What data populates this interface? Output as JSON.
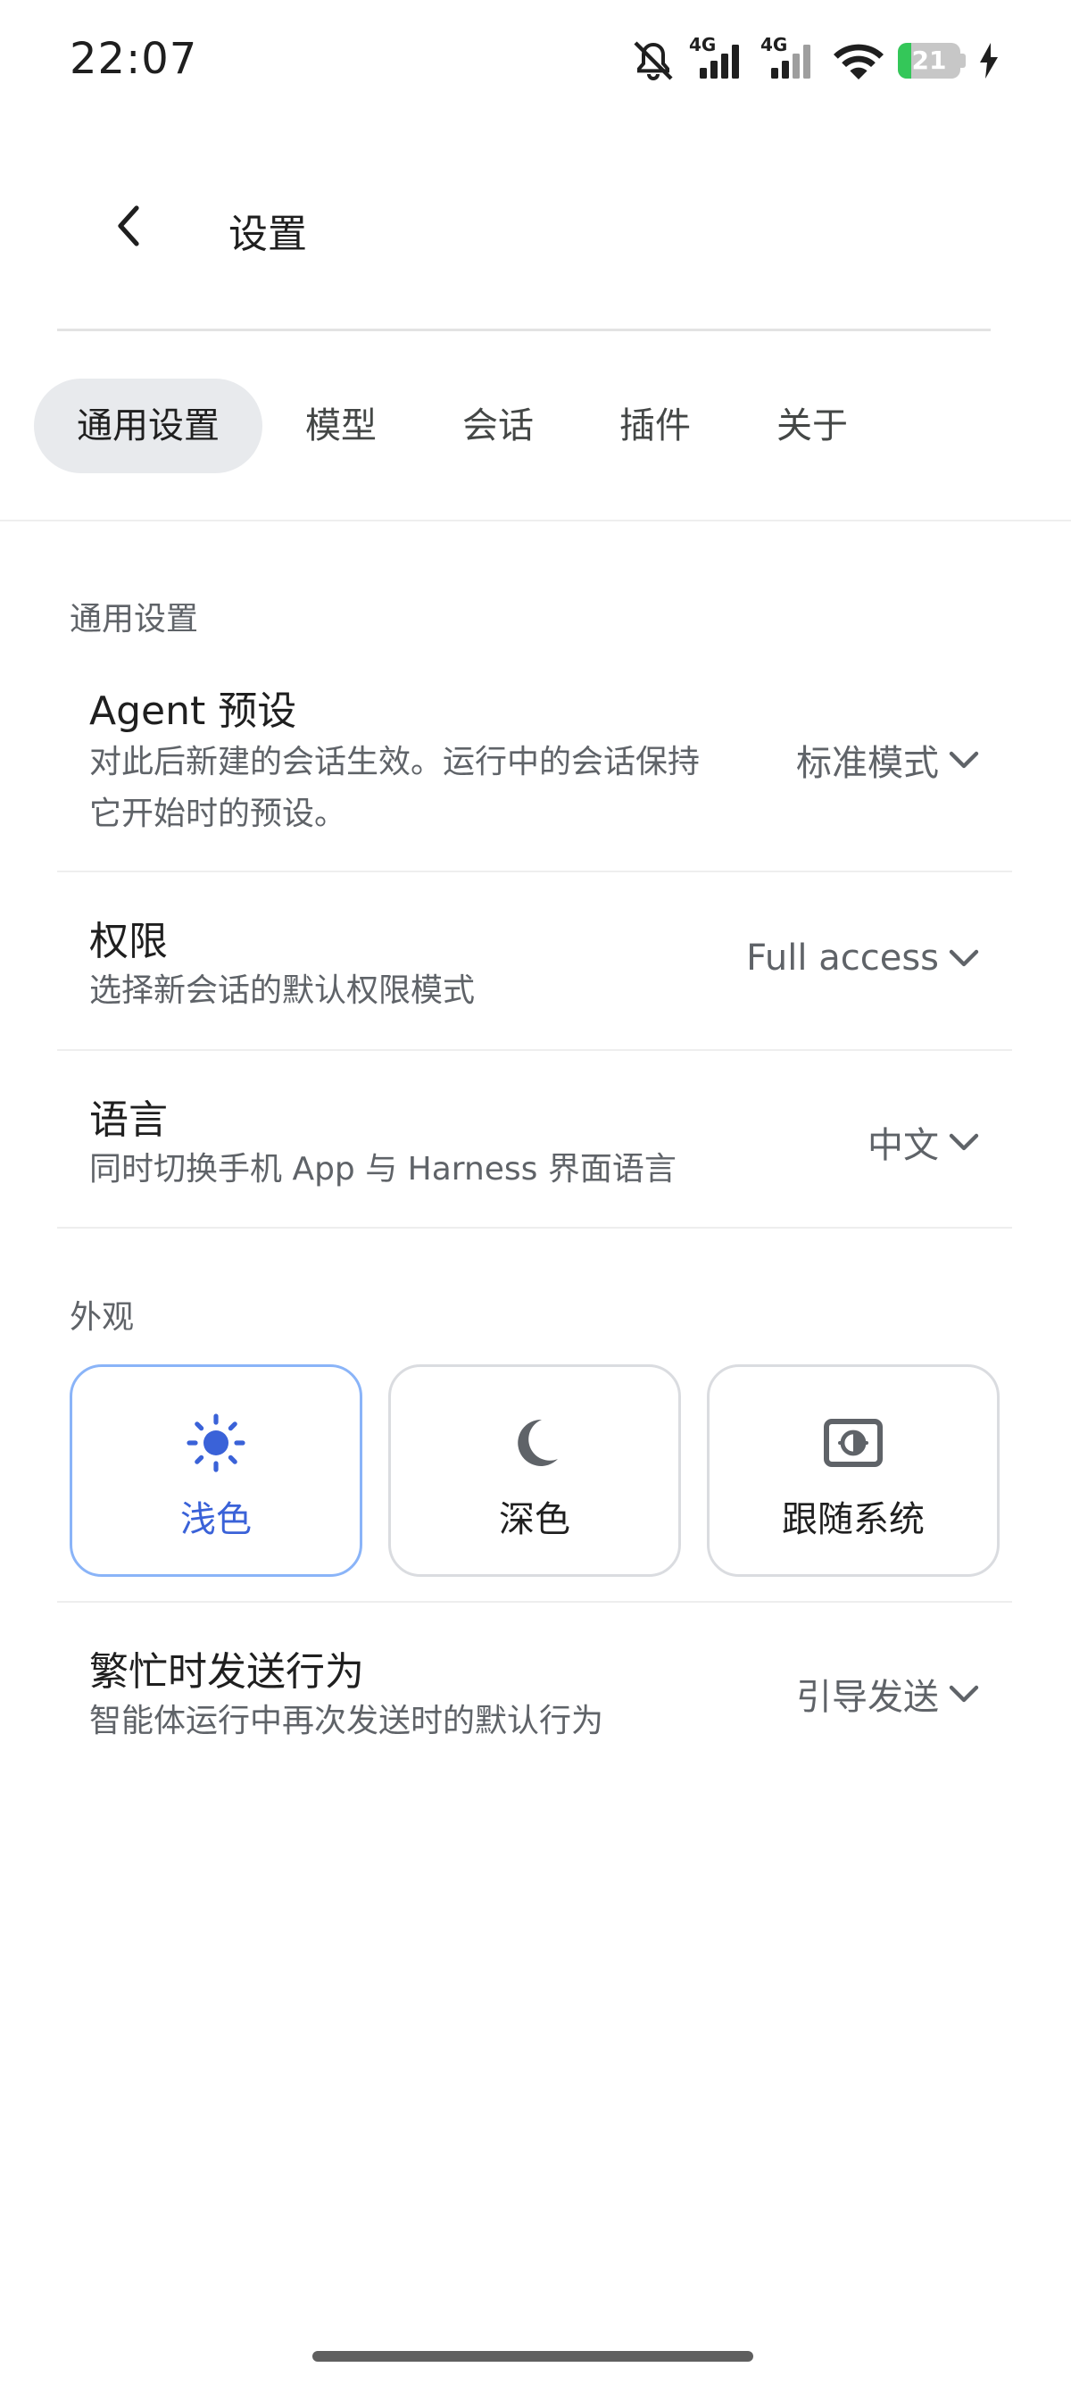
{
  "status_bar": {
    "time": "22:07",
    "signal_1_label": "4G",
    "signal_2_label": "4G",
    "battery_level": "21",
    "icons": [
      "mute-icon",
      "signal-icon",
      "signal-icon",
      "wifi-icon",
      "battery-icon",
      "charging-icon"
    ]
  },
  "header": {
    "title": "设置",
    "back_icon": "chevron-left-icon"
  },
  "tabs": [
    {
      "label": "通用设置",
      "active": true
    },
    {
      "label": "模型",
      "active": false
    },
    {
      "label": "会话",
      "active": false
    },
    {
      "label": "插件",
      "active": false
    },
    {
      "label": "关于",
      "active": false
    }
  ],
  "general": {
    "section_label": "通用设置",
    "agent_preset": {
      "title": "Agent 预设",
      "desc_line1": "对此后新建的会话生效。运行中的会话保持",
      "desc_line2": "它开始时的预设。",
      "value": "标准模式"
    },
    "permissions": {
      "title": "权限",
      "desc": "选择新会话的默认权限模式",
      "value": "Full access"
    },
    "language": {
      "title": "语言",
      "desc": "同时切换手机 App 与 Harness 界面语言",
      "value": "中文"
    }
  },
  "appearance": {
    "section_label": "外观",
    "options": [
      {
        "label": "浅色",
        "icon": "sun-icon",
        "selected": true
      },
      {
        "label": "深色",
        "icon": "moon-icon",
        "selected": false
      },
      {
        "label": "跟随系统",
        "icon": "brightness-auto-icon",
        "selected": false
      }
    ]
  },
  "busy_send": {
    "title": "繁忙时发送行为",
    "desc": "智能体运行中再次发送时的默认行为",
    "value": "引导发送"
  },
  "colors": {
    "accent": "#3a62d8",
    "selected_border": "#8ab4f8",
    "active_tab_bg": "#e8eaed",
    "battery_green": "#34c759"
  }
}
